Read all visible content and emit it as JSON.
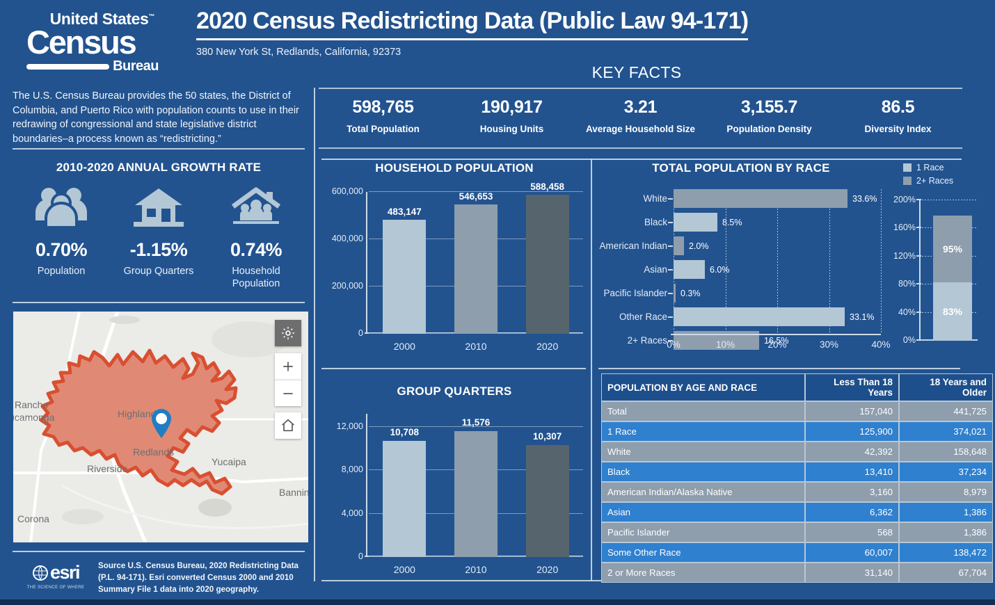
{
  "header": {
    "logo_top": "United States",
    "logo_tm": "™",
    "logo_main": "Census",
    "logo_bureau": "Bureau",
    "title": "2020 Census Redistricting Data (Public Law 94-171)",
    "address": "380 New York St, Redlands, California, 92373"
  },
  "intro": {
    "text": "The U.S. Census Bureau provides the 50 states, the District of Columbia, and Puerto Rico with population counts to use in their redrawing of congressional and state legislative district boundaries–a process known as “redistricting.”"
  },
  "key_facts": {
    "title": "KEY FACTS",
    "items": [
      {
        "value": "598,765",
        "label": "Total Population"
      },
      {
        "value": "190,917",
        "label": "Housing Units"
      },
      {
        "value": "3.21",
        "label": "Average Household Size"
      },
      {
        "value": "3,155.7",
        "label": "Population Density"
      },
      {
        "value": "86.5",
        "label": "Diversity Index"
      }
    ]
  },
  "growth": {
    "title": "2010-2020 ANNUAL GROWTH RATE",
    "items": [
      {
        "icon": "people-group-icon",
        "value": "0.70%",
        "label": "Population"
      },
      {
        "icon": "house-icon",
        "value": "-1.15%",
        "label": "Group Quarters"
      },
      {
        "icon": "household-icon",
        "value": "0.74%",
        "label": "Household Population"
      }
    ]
  },
  "map": {
    "name": "redlands-locator-map",
    "labels": [
      "Rancho Cucamonga",
      "Highland",
      "Redlands",
      "Yucaipa",
      "Riverside",
      "Banning",
      "Corona"
    ],
    "controls": [
      "gear-icon",
      "zoom-in-icon",
      "zoom-out-icon",
      "home-icon"
    ],
    "boundary_color": "#d94f31",
    "fill_color": "#e08a75",
    "pin_color": "#1f7dc4"
  },
  "footer": {
    "esri_word": "esri",
    "esri_tagline": "THE SCIENCE OF WHERE",
    "source": "Source U.S. Census Bureau, 2020 Redistricting Data (P.L. 94-171).  Esri converted Census 2000 and 2010 Summary File 1 data into 2020 geography."
  },
  "colors": {
    "background": "#22538f",
    "bar_light": "#b3c7d5",
    "bar_mid": "#8e9ead",
    "bar_dark": "#56646d",
    "table_header": "#1d4f8c",
    "row_gray": "#8e9ead",
    "row_blue": "#2f80cf"
  },
  "chart_data": [
    {
      "type": "bar",
      "name": "household-population-chart",
      "title": "HOUSEHOLD POPULATION",
      "categories": [
        "2000",
        "2010",
        "2020"
      ],
      "values": [
        483147,
        546653,
        588458
      ],
      "data_labels": [
        "483,147",
        "546,653",
        "588,458"
      ],
      "yticks": [
        0,
        200000,
        400000,
        600000
      ],
      "ytick_labels": [
        "0",
        "200,000",
        "400,000",
        "600,000"
      ],
      "ylim": [
        0,
        660000
      ],
      "bar_colors": [
        "#b3c7d5",
        "#8e9ead",
        "#56646d"
      ],
      "xlabel": "",
      "ylabel": "",
      "grid": true
    },
    {
      "type": "bar",
      "name": "group-quarters-chart",
      "title": "GROUP QUARTERS",
      "categories": [
        "2000",
        "2010",
        "2020"
      ],
      "values": [
        10708,
        11576,
        10307
      ],
      "data_labels": [
        "10,708",
        "11,576",
        "10,307"
      ],
      "yticks": [
        0,
        4000,
        8000,
        12000
      ],
      "ytick_labels": [
        "0",
        "4,000",
        "8,000",
        "12,000"
      ],
      "ylim": [
        0,
        13200
      ],
      "bar_colors": [
        "#b3c7d5",
        "#8e9ead",
        "#56646d"
      ],
      "xlabel": "",
      "ylabel": "",
      "grid": true
    },
    {
      "type": "bar",
      "orientation": "horizontal",
      "name": "total-population-by-race-chart",
      "title": "TOTAL POPULATION BY RACE",
      "categories": [
        "White",
        "Black",
        "American Indian",
        "Asian",
        "Pacific Islander",
        "Other Race",
        "2+ Races"
      ],
      "values": [
        33.6,
        8.5,
        2.0,
        6.0,
        0.3,
        33.1,
        16.5
      ],
      "data_labels": [
        "33.6%",
        "8.5%",
        "2.0%",
        "6.0%",
        "0.3%",
        "33.1%",
        "16.5%"
      ],
      "bar_colors": [
        "#8e9ead",
        "#b3c7d5",
        "#8e9ead",
        "#b3c7d5",
        "#8e9ead",
        "#b3c7d5",
        "#8e9ead"
      ],
      "xticks": [
        0,
        10,
        20,
        30,
        40
      ],
      "xtick_labels": [
        "0%",
        "10%",
        "20%",
        "30%",
        "40%"
      ],
      "xlim": [
        0,
        40
      ],
      "xlabel": "",
      "ylabel": "",
      "grid": true
    },
    {
      "type": "bar",
      "stacked": true,
      "name": "race-share-stacked-chart",
      "title": "",
      "legend": [
        {
          "label": "1 Race",
          "color": "#b3c7d5"
        },
        {
          "label": "2+ Races",
          "color": "#8e9ead"
        }
      ],
      "legend_position": "top-right",
      "segments": [
        {
          "name": "1 Race",
          "value": 83,
          "label": "83%",
          "color": "#b3c7d5"
        },
        {
          "name": "2+ Races",
          "value": 95,
          "label": "95%",
          "color": "#8e9ead"
        }
      ],
      "yticks": [
        0,
        40,
        80,
        120,
        160,
        200
      ],
      "ytick_labels": [
        "0%",
        "40%",
        "80%",
        "120%",
        "160%",
        "200%"
      ],
      "ylim": [
        0,
        200
      ],
      "grid": true
    }
  ],
  "table": {
    "name": "population-by-age-and-race-table",
    "headers": [
      "POPULATION BY AGE AND RACE",
      "Less Than 18 Years",
      "18 Years and Older"
    ],
    "rows": [
      {
        "label": "Total",
        "indent": 0,
        "style": "gray",
        "under18": "157,040",
        "over18": "441,725"
      },
      {
        "label": "1 Race",
        "indent": 1,
        "style": "blue",
        "under18": "125,900",
        "over18": "374,021"
      },
      {
        "label": "White",
        "indent": 2,
        "style": "gray",
        "under18": "42,392",
        "over18": "158,648"
      },
      {
        "label": "Black",
        "indent": 2,
        "style": "blue",
        "under18": "13,410",
        "over18": "37,234"
      },
      {
        "label": "American Indian/Alaska Native",
        "indent": 2,
        "style": "gray",
        "under18": "3,160",
        "over18": "8,979"
      },
      {
        "label": "Asian",
        "indent": 2,
        "style": "blue",
        "under18": "6,362",
        "over18": "1,386"
      },
      {
        "label": "Pacific Islander",
        "indent": 2,
        "style": "gray",
        "under18": "568",
        "over18": "1,386"
      },
      {
        "label": "Some Other Race",
        "indent": 2,
        "style": "blue",
        "under18": "60,007",
        "over18": "138,472"
      },
      {
        "label": "2 or More Races",
        "indent": 1,
        "style": "gray",
        "under18": "31,140",
        "over18": "67,704"
      }
    ]
  }
}
